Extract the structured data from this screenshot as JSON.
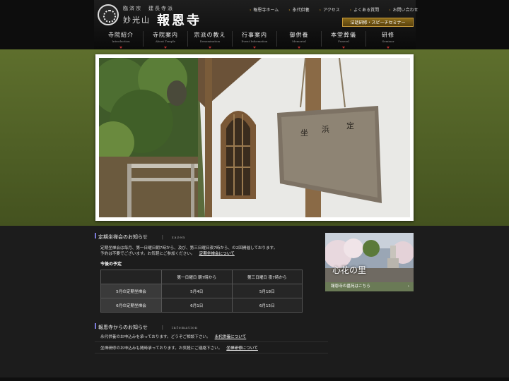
{
  "site": {
    "sect_and_temple": "臨済宗　建長寺派",
    "mountain_name": "妙光山",
    "temple_name": "報恩寺"
  },
  "util_nav": [
    "報恩寺ホーム",
    "永代供養",
    "アクセス",
    "よくある質問",
    "お問い合わせ"
  ],
  "seminar_button": "法話研修・スピーチセミナー",
  "global_nav": [
    {
      "jp": "寺院紹介",
      "en": "Introduction"
    },
    {
      "jp": "寺院案内",
      "en": "About Temple"
    },
    {
      "jp": "宗派の教え",
      "en": "Denomination"
    },
    {
      "jp": "行事案内",
      "en": "Event Information"
    },
    {
      "jp": "御供養",
      "en": "Memorial"
    },
    {
      "jp": "本堂葬儀",
      "en": "Funeral"
    },
    {
      "jp": "研修",
      "en": "Seminar"
    }
  ],
  "zazen": {
    "title": "定期坐禅会のお知らせ",
    "sep": "|",
    "en": "zazen",
    "line1": "定期坐禅会は毎月、第一日曜日朝7時から、及び、第三日曜日夜7時から、の2回開催しております。",
    "line2": "予約は不要でございます。お気軽にご参加ください。",
    "link": "定期坐禅会について",
    "schedule_heading": "今後の予定",
    "table": {
      "columns": [
        "",
        "第一日曜日 朝7時から",
        "第三日曜日 夜7時から"
      ],
      "rows": [
        {
          "month": "5月の定期坐禅会",
          "first": "5月4日",
          "third": "5月18日"
        },
        {
          "month": "6月の定期坐禅会",
          "first": "6月1日",
          "third": "6月15日"
        }
      ]
    }
  },
  "banner": {
    "title": "心花の里",
    "link": "報恩寺の墓苑はこちら",
    "arrow": "›"
  },
  "info": {
    "title": "報恩寺からのお知らせ",
    "sep": "|",
    "en": "infomation",
    "items": [
      {
        "text": "永代供養のお申込みを承っております。どうぞご相談下さい。",
        "link": "永代供養について"
      },
      {
        "text": "坐禅研修のお申込みも随時承っております。お気軽にご連絡下さい。",
        "link": "坐禅研修について"
      }
    ]
  },
  "colors": {
    "hero_green": "#5e6f2d",
    "accent_gold": "#8a6a1a",
    "nav_caret_red": "#c03030",
    "banner_link_green": "#6a7a56"
  }
}
